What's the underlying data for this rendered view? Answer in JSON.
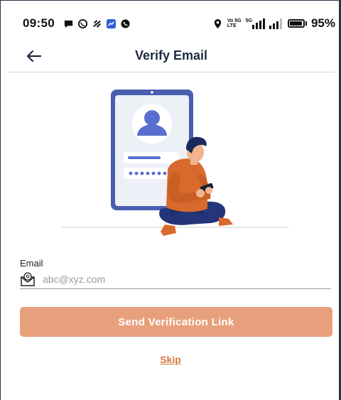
{
  "status_bar": {
    "time": "09:50",
    "network_top": "Vo 5G",
    "network_bottom": "LTE",
    "net_type": "5G",
    "battery": "95%",
    "battery_level": 0.95
  },
  "header": {
    "title": "Verify Email"
  },
  "form": {
    "email_label": "Email",
    "email_placeholder": "abc@xyz.com",
    "email_value": "",
    "send_button": "Send Verification Link",
    "skip_link": "Skip"
  },
  "colors": {
    "accent": "#e8a07c",
    "link": "#d1763f",
    "title": "#1f2a44",
    "phone_frame": "#4a5eb0",
    "avatar": "#5a6ecf"
  },
  "icons": {
    "back": "arrow-left-icon",
    "email": "envelope-at-icon"
  }
}
